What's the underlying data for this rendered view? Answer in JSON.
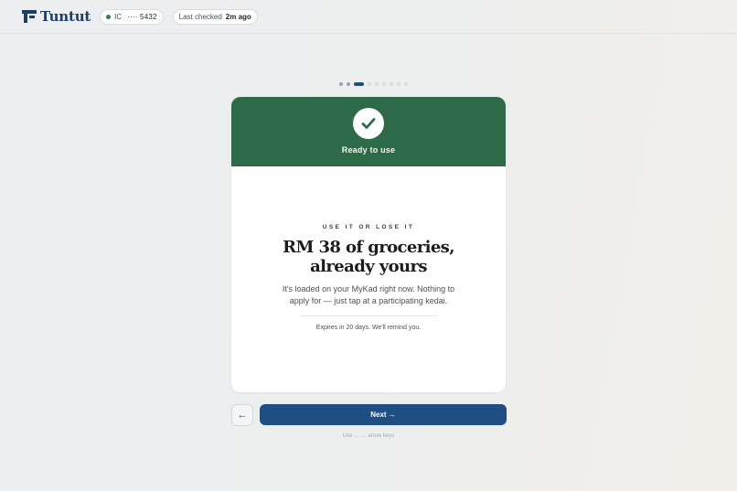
{
  "brand": {
    "name": "Tuntut",
    "accent": "#1c3f66"
  },
  "header": {
    "ic_label": "IC",
    "ic_masked": "···· 5432",
    "last_checked_label": "Last checked",
    "last_checked_value": "2m ago"
  },
  "progress": {
    "total": 9,
    "current": 3
  },
  "card": {
    "status_label": "Ready to use",
    "status_color": "#2c6a48",
    "eyebrow": "USE IT OR LOSE IT",
    "headline": "RM 38 of groceries, already yours",
    "description": "It's loaded on your MyKad right now. Nothing to apply for — just tap at a participating kedai.",
    "expires": "Expires in 20 days. We'll remind you."
  },
  "nav": {
    "back_label": "←",
    "next_label": "Next →",
    "hint": "Use ← → arrow keys"
  }
}
